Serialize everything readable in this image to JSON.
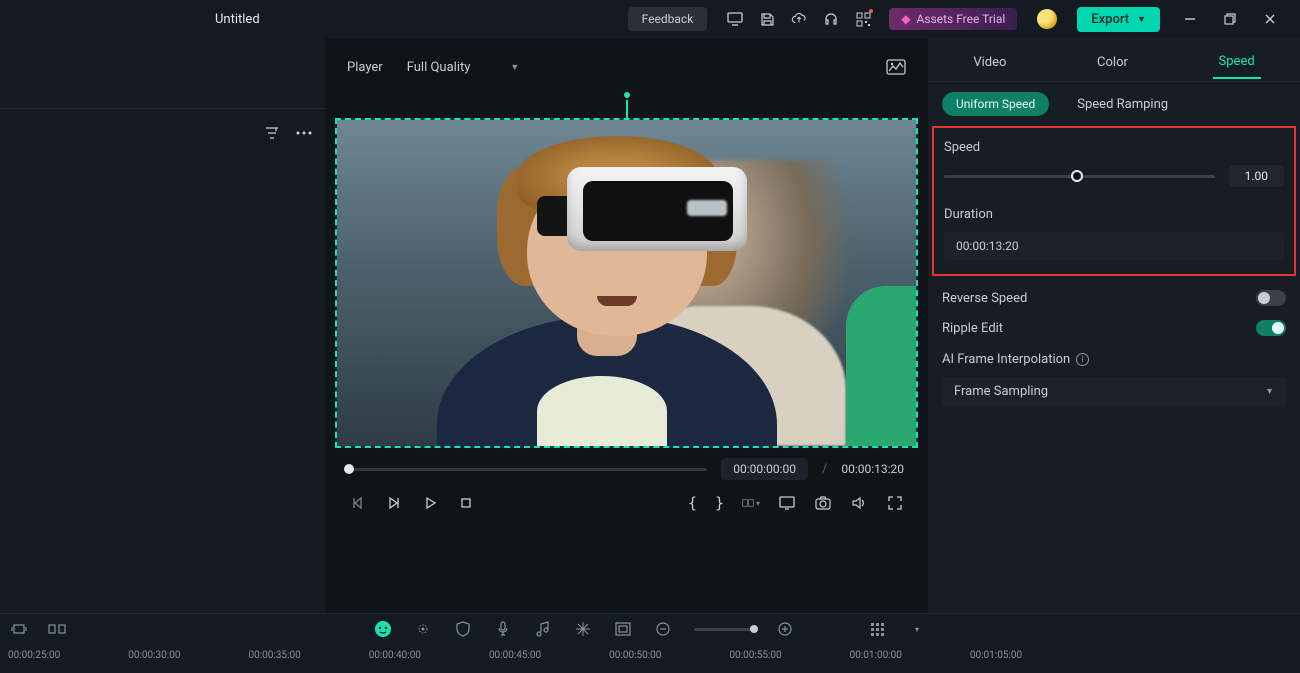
{
  "header": {
    "title": "Untitled",
    "feedback": "Feedback",
    "assets_trial": "Assets Free Trial",
    "export": "Export"
  },
  "player": {
    "label": "Player",
    "quality": "Full Quality",
    "current_time": "00:00:00:00",
    "separator": "/",
    "duration": "00:00:13:20"
  },
  "right": {
    "tabs": {
      "video": "Video",
      "color": "Color",
      "speed": "Speed"
    },
    "subtabs": {
      "uniform": "Uniform Speed",
      "ramping": "Speed Ramping"
    },
    "speed_label": "Speed",
    "speed_value": "1.00",
    "duration_label": "Duration",
    "duration_value": "00:00:13:20",
    "reverse_label": "Reverse Speed",
    "ripple_label": "Ripple Edit",
    "ai_label": "AI Frame Interpolation",
    "interpolation_value": "Frame Sampling"
  },
  "timeline": {
    "ticks": [
      "00:00:25:00",
      "00:00:30:00",
      "00:00:35:00",
      "00:00:40:00",
      "00:00:45:00",
      "00:00:50:00",
      "00:00:55:00",
      "00:01:00:00",
      "00:01:05:00"
    ]
  }
}
